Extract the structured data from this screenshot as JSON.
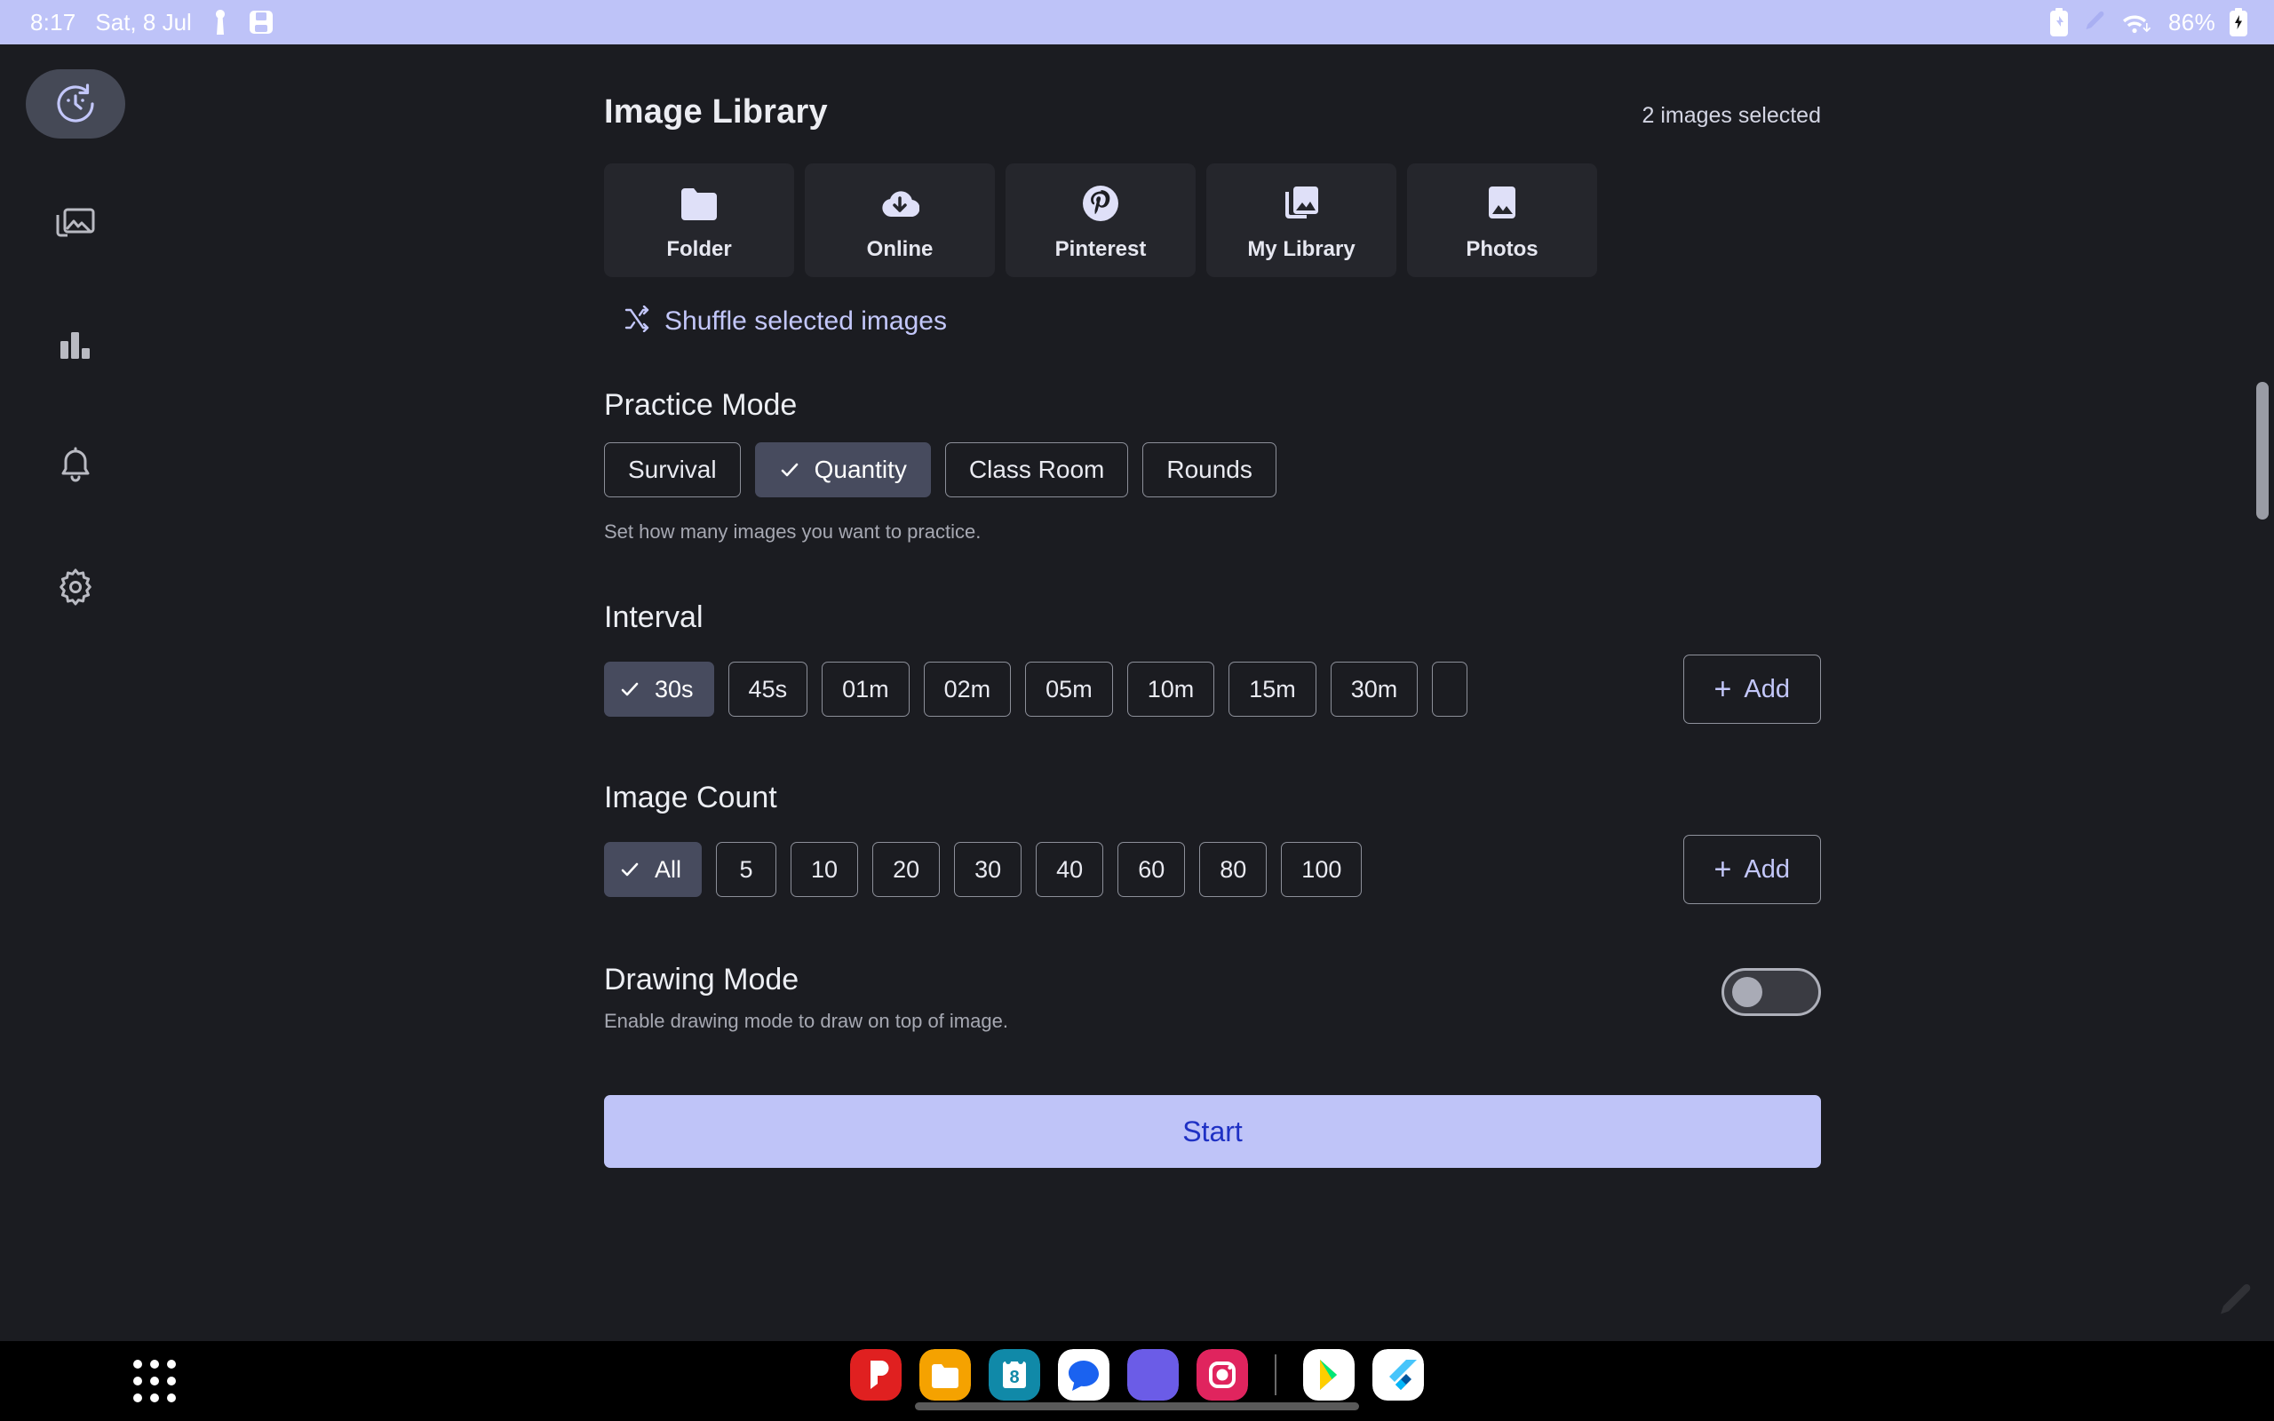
{
  "status_bar": {
    "time": "8:17",
    "date": "Sat, 8 Jul",
    "battery_percent": "86%",
    "icons_left": [
      "key-icon",
      "save-icon"
    ],
    "icons_right": [
      "battery-saver-icon",
      "pencil-icon",
      "wifi-icon",
      "battery-charging-icon"
    ],
    "background_color": "#bec3f8"
  },
  "sidebar": {
    "items": [
      {
        "name": "timer",
        "icon": "timer-icon",
        "active": true
      },
      {
        "name": "gallery",
        "icon": "gallery-icon",
        "active": false
      },
      {
        "name": "stats",
        "icon": "bar-chart-icon",
        "active": false
      },
      {
        "name": "notifications",
        "icon": "bell-icon",
        "active": false
      },
      {
        "name": "settings",
        "icon": "gear-icon",
        "active": false
      }
    ]
  },
  "header": {
    "title": "Image Library",
    "selection_status": "2 images selected"
  },
  "sources": [
    {
      "label": "Folder",
      "icon": "folder-icon"
    },
    {
      "label": "Online",
      "icon": "cloud-download-icon"
    },
    {
      "label": "Pinterest",
      "icon": "pinterest-icon"
    },
    {
      "label": "My Library",
      "icon": "image-stack-icon"
    },
    {
      "label": "Photos",
      "icon": "photo-icon"
    }
  ],
  "shuffle": {
    "label": "Shuffle selected images",
    "icon": "shuffle-icon",
    "color": "#c3c7fa"
  },
  "practice_mode": {
    "title": "Practice Mode",
    "description": "Set how many images you want to practice.",
    "options": [
      {
        "label": "Survival",
        "selected": false
      },
      {
        "label": "Quantity",
        "selected": true
      },
      {
        "label": "Class Room",
        "selected": false
      },
      {
        "label": "Rounds",
        "selected": false
      }
    ]
  },
  "interval": {
    "title": "Interval",
    "options": [
      {
        "label": "30s",
        "selected": true
      },
      {
        "label": "45s",
        "selected": false
      },
      {
        "label": "01m",
        "selected": false
      },
      {
        "label": "02m",
        "selected": false
      },
      {
        "label": "05m",
        "selected": false
      },
      {
        "label": "10m",
        "selected": false
      },
      {
        "label": "15m",
        "selected": false
      },
      {
        "label": "30m",
        "selected": false
      }
    ],
    "add_label": "Add"
  },
  "image_count": {
    "title": "Image Count",
    "options": [
      {
        "label": "All",
        "selected": true
      },
      {
        "label": "5",
        "selected": false
      },
      {
        "label": "10",
        "selected": false
      },
      {
        "label": "20",
        "selected": false
      },
      {
        "label": "30",
        "selected": false
      },
      {
        "label": "40",
        "selected": false
      },
      {
        "label": "60",
        "selected": false
      },
      {
        "label": "80",
        "selected": false
      },
      {
        "label": "100",
        "selected": false
      }
    ],
    "add_label": "Add"
  },
  "drawing_mode": {
    "title": "Drawing Mode",
    "description": "Enable drawing mode to draw on top of image.",
    "enabled": false
  },
  "start_button": {
    "label": "Start",
    "background_color": "#bfc4f8",
    "text_color": "#1f31c4"
  },
  "taskbar": {
    "launcher": "app-grid-icon",
    "apps": [
      {
        "name": "pinterest",
        "color": "#e02020"
      },
      {
        "name": "files",
        "color": "#f5a200"
      },
      {
        "name": "calendar",
        "color": "#1089a8",
        "badge": "8"
      },
      {
        "name": "messages",
        "color": "#ffffff"
      },
      {
        "name": "chrome-alt",
        "color": "#6b5ce7"
      },
      {
        "name": "instagram",
        "color": "#e0245e"
      },
      {
        "name": "play-store",
        "color": "#ffffff"
      },
      {
        "name": "flutter",
        "color": "#ffffff"
      }
    ]
  },
  "theme": {
    "background": "#1b1c21",
    "card": "#25262c",
    "selected_chip": "#474b5e",
    "accent": "#c3c7fa"
  }
}
